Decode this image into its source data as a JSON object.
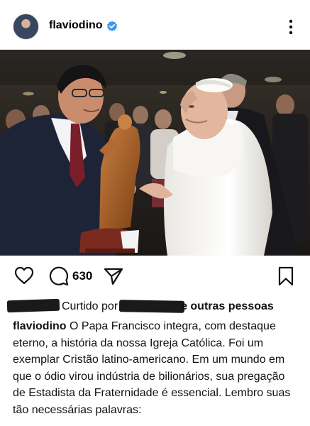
{
  "post": {
    "username": "flaviodino",
    "verified": true,
    "comment_count": "630",
    "liked_by_prefix": "Curtido por",
    "liked_by_suffix": "e outras pessoas",
    "caption_user": "flaviodino",
    "caption_text": "O Papa Francisco integra, com destaque eterno, a história da nossa Igreja Católica. Foi um exemplar Cristão latino-americano. Em um mundo em que o ódio virou indústria de bilionários, sua pregação de Estadista da Fraternidade é essencial. Lembro suas tão necessárias palavras:"
  },
  "icons": {
    "verified": "verified-badge-icon",
    "more": "more-options-icon",
    "like": "heart-icon",
    "comment": "comment-icon",
    "share": "send-icon",
    "save": "bookmark-icon"
  },
  "colors": {
    "verified": "#3897f0",
    "text": "#111111"
  }
}
